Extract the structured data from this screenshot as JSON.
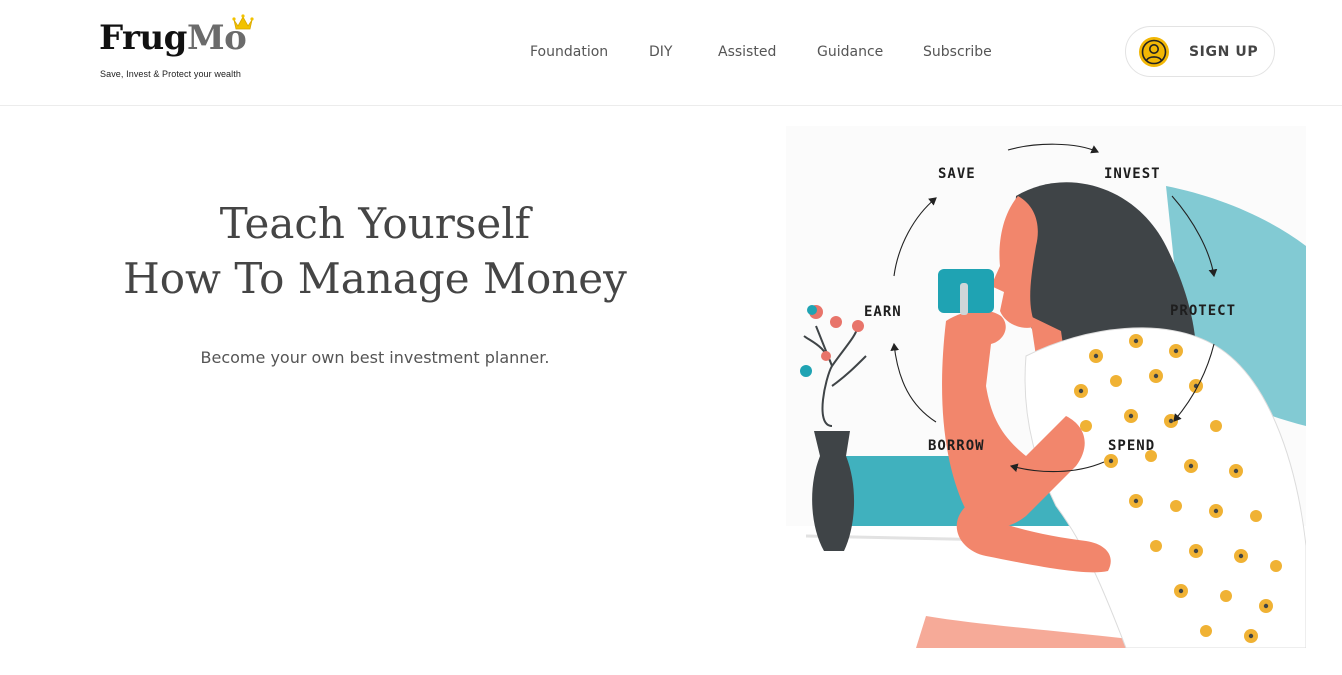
{
  "brand": {
    "name_part1": "Frug",
    "name_part2": "Mo",
    "tagline": "Save, Invest & Protect your wealth"
  },
  "nav": {
    "items": [
      {
        "label": "Foundation"
      },
      {
        "label": "DIY"
      },
      {
        "label": "Assisted"
      },
      {
        "label": "Guidance"
      },
      {
        "label": "Subscribe"
      }
    ]
  },
  "signup": {
    "label": "SIGN UP",
    "icon": "user-circle-icon",
    "icon_color": "#f2b705"
  },
  "hero": {
    "title_line1": "Teach Yourself",
    "title_line2": "How To Manage Money",
    "subtitle": "Become your own best investment planner."
  },
  "cycle": {
    "steps": [
      "SAVE",
      "INVEST",
      "PROTECT",
      "SPEND",
      "BORROW",
      "EARN"
    ]
  },
  "colors": {
    "skin": "#f2866c",
    "hair": "#3f4447",
    "teal": "#1fa3b3",
    "flower_yellow": "#f0b234",
    "vase": "#3f4447"
  }
}
